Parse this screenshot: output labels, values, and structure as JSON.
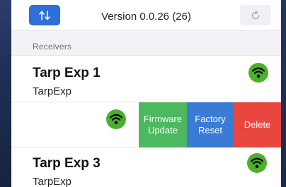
{
  "header": {
    "version_text": "Version 0.0.26 (26)",
    "sort_icon": "up-down-arrows-icon",
    "refresh_icon": "refresh-icon"
  },
  "section": {
    "title": "Receivers"
  },
  "receivers": [
    {
      "name": "Tarp Exp 1",
      "type": "TarpExp",
      "signal_icon": "wifi-signal-icon"
    },
    {
      "name": "Tarp Exp 3",
      "type": "TarpExp",
      "signal_icon": "wifi-signal-icon"
    }
  ],
  "swipe_actions": {
    "firmware_update": "Firmware Update",
    "factory_reset": "Factory Reset",
    "delete": "Delete"
  },
  "colors": {
    "accent_blue": "#2f6fd6",
    "firmware_green": "#4cb85f",
    "reset_blue": "#3a7bd5",
    "delete_red": "#e9463f",
    "signal_green": "#4caf2e"
  }
}
